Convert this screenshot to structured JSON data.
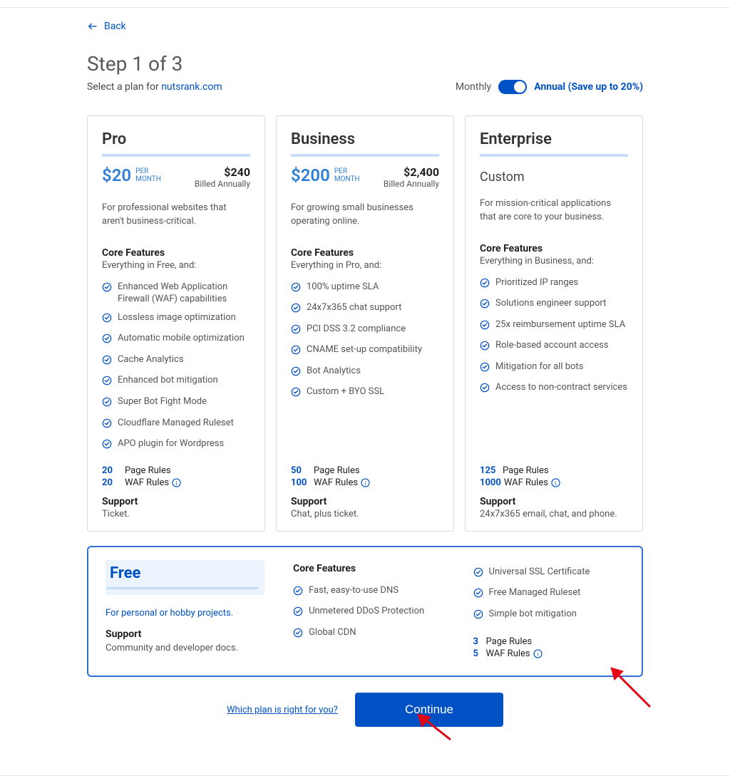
{
  "nav": {
    "back": "Back"
  },
  "header": {
    "step_title": "Step 1 of 3",
    "subtitle_prefix": "Select a plan for ",
    "domain": "nutsrank.com"
  },
  "billing": {
    "monthly_label": "Monthly",
    "annual_label": "Annual (Save up to 20%)"
  },
  "plans": {
    "pro": {
      "name": "Pro",
      "price": "$20",
      "per_line1": "PER",
      "per_line2": "MONTH",
      "total": "$240",
      "billed": "Billed Annually",
      "desc": "For professional websites that aren't business-critical.",
      "core_h": "Core Features",
      "core_sub": "Everything in Free, and:",
      "features": [
        "Enhanced Web Application Firewall (WAF) capabilities",
        "Lossless image optimization",
        "Automatic mobile optimization",
        "Cache Analytics",
        "Enhanced bot mitigation",
        "Super Bot Fight Mode",
        "Cloudflare Managed Ruleset",
        "APO plugin for Wordpress"
      ],
      "page_rules_n": "20",
      "page_rules_l": "Page Rules",
      "waf_rules_n": "20",
      "waf_rules_l": "WAF Rules",
      "support_h": "Support",
      "support_t": "Ticket."
    },
    "business": {
      "name": "Business",
      "price": "$200",
      "per_line1": "PER",
      "per_line2": "MONTH",
      "total": "$2,400",
      "billed": "Billed Annually",
      "desc": "For growing small businesses operating online.",
      "core_h": "Core Features",
      "core_sub": "Everything in Pro, and:",
      "features": [
        "100% uptime SLA",
        "24x7x365 chat support",
        "PCI DSS 3.2 compliance",
        "CNAME set-up compatibility",
        "Bot Analytics",
        "Custom + BYO SSL"
      ],
      "page_rules_n": "50",
      "page_rules_l": "Page Rules",
      "waf_rules_n": "100",
      "waf_rules_l": "WAF Rules",
      "support_h": "Support",
      "support_t": "Chat, plus ticket."
    },
    "enterprise": {
      "name": "Enterprise",
      "custom": "Custom",
      "desc": "For mission-critical applications that are core to your business.",
      "core_h": "Core Features",
      "core_sub": "Everything in Business, and:",
      "features": [
        "Prioritized IP ranges",
        "Solutions engineer support",
        "25x reimbursement uptime SLA",
        "Role-based account access",
        "Mitigation for all bots",
        "Access to non-contract services"
      ],
      "page_rules_n": "125",
      "page_rules_l": "Page Rules",
      "waf_rules_n": "1000",
      "waf_rules_l": "WAF Rules",
      "support_h": "Support",
      "support_t": "24x7x365 email, chat, and phone."
    }
  },
  "free": {
    "name": "Free",
    "desc": "For personal or hobby projects.",
    "support_h": "Support",
    "support_t": "Community and developer docs.",
    "core_h": "Core Features",
    "features_a": [
      "Fast, easy-to-use DNS",
      "Unmetered DDoS Protection",
      "Global CDN"
    ],
    "features_b": [
      "Universal SSL Certificate",
      "Free Managed Ruleset",
      "Simple bot mitigation"
    ],
    "page_rules_n": "3",
    "page_rules_l": "Page Rules",
    "waf_rules_n": "5",
    "waf_rules_l": "WAF Rules"
  },
  "footer": {
    "which_link": "Which plan is right for you?",
    "continue": "Continue"
  }
}
